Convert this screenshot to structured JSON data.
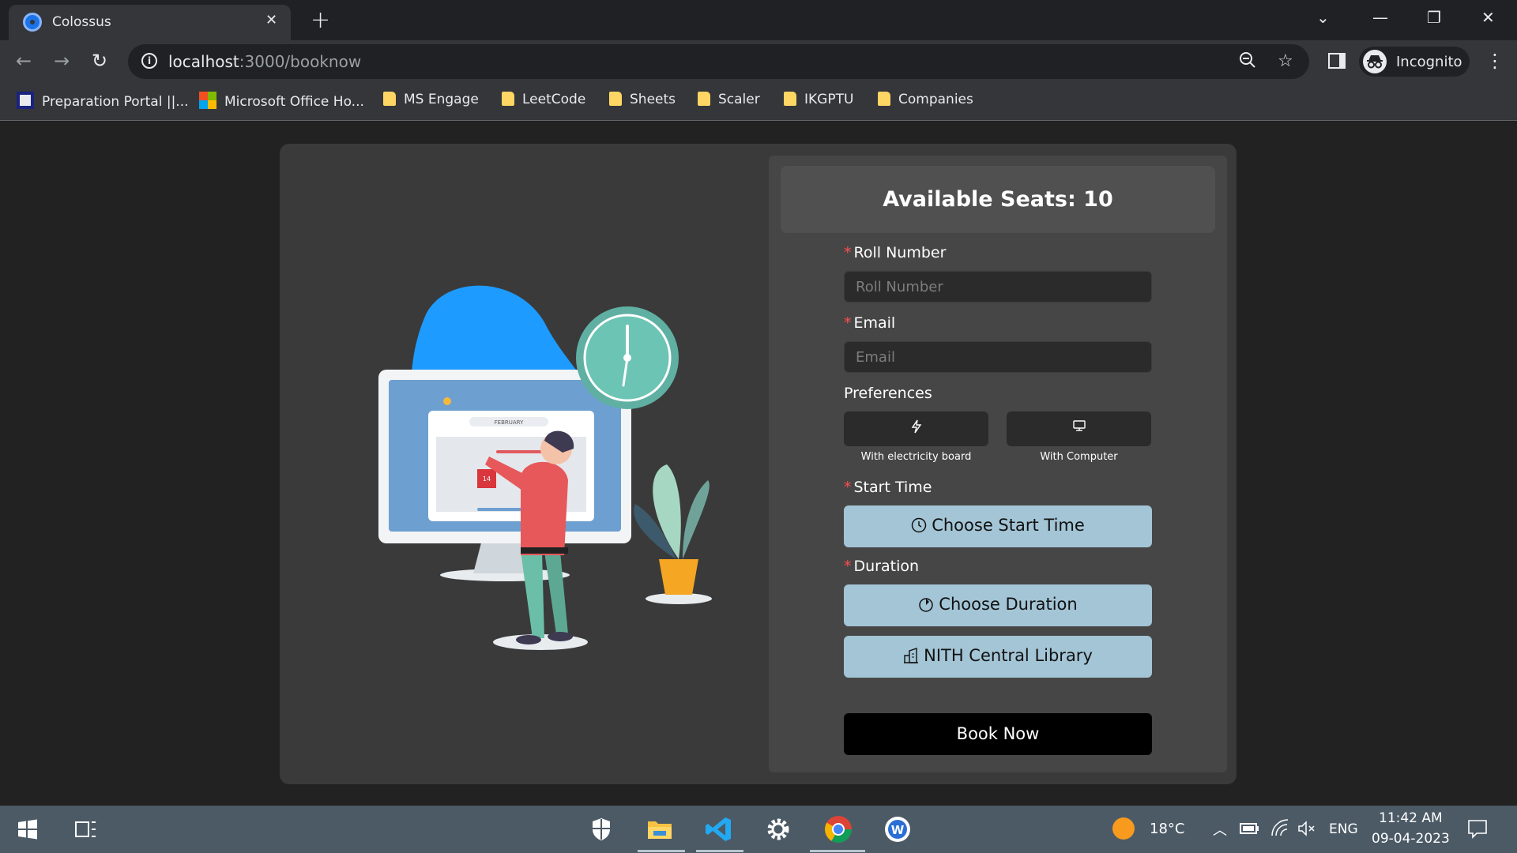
{
  "browser": {
    "tab": {
      "title": "Colossus",
      "close": "✕"
    },
    "new_tab": "+",
    "window": {
      "chevron": "⌄",
      "minimize": "—",
      "restore": "❐",
      "close": "✕"
    },
    "nav": {
      "back": "←",
      "forward": "→",
      "reload": "↻"
    },
    "url": {
      "host": "localhost",
      "path": ":3000/booknow"
    },
    "profile_label": "Incognito",
    "menu": "⋮",
    "bookmarks": [
      {
        "label": "Preparation Portal ||...",
        "icon": "prep-portal-icon"
      },
      {
        "label": "Microsoft Office Ho...",
        "icon": "microsoft-icon"
      },
      {
        "label": "MS Engage",
        "icon": "folder-icon"
      },
      {
        "label": "LeetCode",
        "icon": "folder-icon"
      },
      {
        "label": "Sheets",
        "icon": "folder-icon"
      },
      {
        "label": "Scaler",
        "icon": "folder-icon"
      },
      {
        "label": "IKGPTU",
        "icon": "folder-icon"
      },
      {
        "label": "Companies",
        "icon": "folder-icon"
      }
    ]
  },
  "booking": {
    "available_seats": "Available Seats: 10",
    "roll": {
      "label": "Roll Number",
      "placeholder": "Roll Number"
    },
    "email": {
      "label": "Email",
      "placeholder": "Email"
    },
    "preferences": {
      "label": "Preferences",
      "options": [
        {
          "caption": "With electricity board",
          "icon": "lightning-icon"
        },
        {
          "caption": "With Computer",
          "icon": "monitor-icon"
        }
      ]
    },
    "start_time": {
      "label": "Start Time",
      "button": "Choose Start Time"
    },
    "duration": {
      "label": "Duration",
      "button": "Choose Duration"
    },
    "library_button": "NITH Central Library",
    "book_button": "Book Now",
    "required_mark": "*"
  },
  "taskbar": {
    "weather": "18°C",
    "language": "ENG",
    "time": "11:42 AM",
    "date": "09-04-2023"
  },
  "colors": {
    "accent_button": "#a3c5d6",
    "panel": "#464646",
    "card": "#3a3a3a",
    "required": "#ff4d4f"
  }
}
